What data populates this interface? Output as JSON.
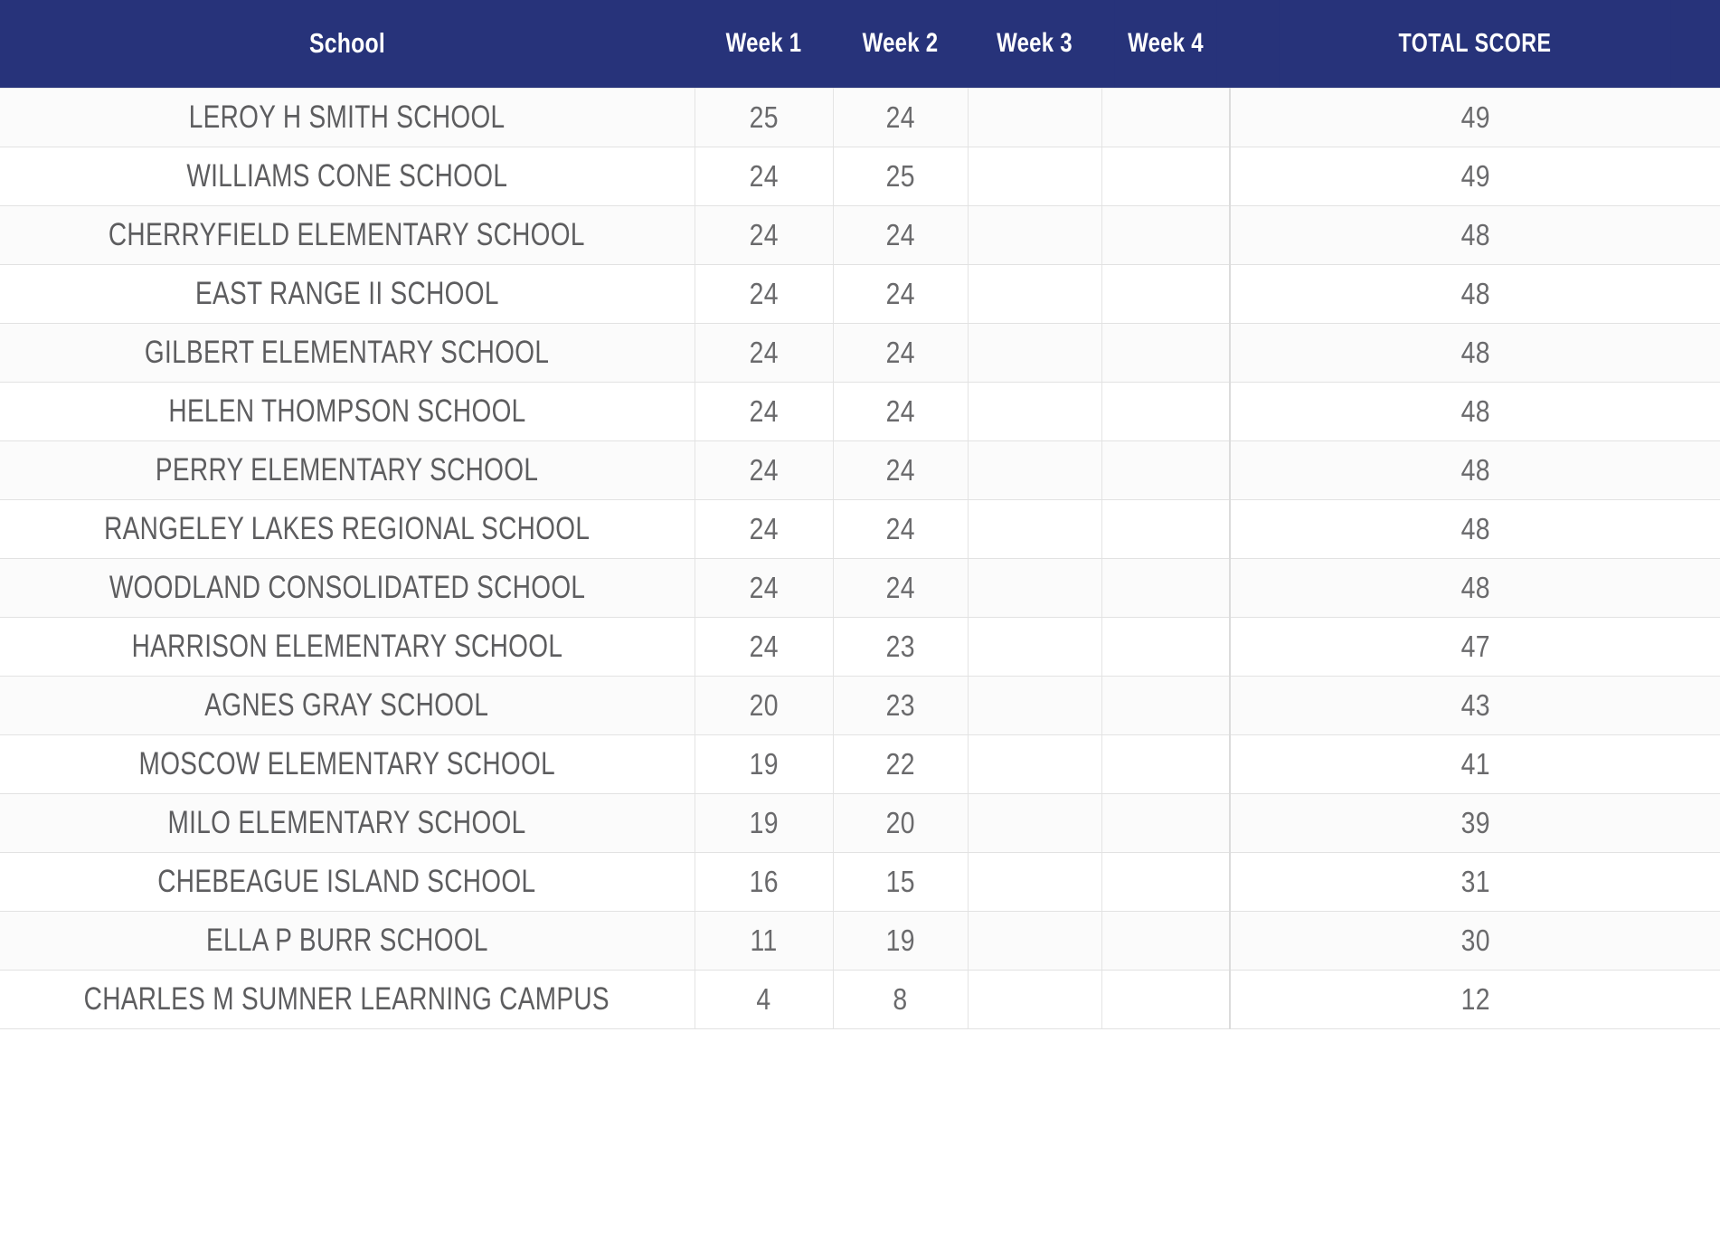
{
  "table": {
    "accent_color": "#27337a",
    "header_text_color": "#ffffff",
    "body_text_color": "#58585a",
    "row_alt_color": "#fbfbfb",
    "row_color": "#ffffff",
    "border_color": "#e4e4e4",
    "columns": [
      {
        "key": "school",
        "label": "School",
        "align": "center"
      },
      {
        "key": "week1",
        "label": "Week 1",
        "align": "center"
      },
      {
        "key": "week2",
        "label": "Week 2",
        "align": "center"
      },
      {
        "key": "week3",
        "label": "Week 3",
        "align": "center"
      },
      {
        "key": "week4",
        "label": "Week 4",
        "align": "center"
      },
      {
        "key": "total",
        "label": "TOTAL SCORE",
        "align": "center"
      }
    ],
    "rows": [
      {
        "school": "LEROY H SMITH SCHOOL",
        "week1": "25",
        "week2": "24",
        "week3": "",
        "week4": "",
        "total": "49"
      },
      {
        "school": "WILLIAMS CONE SCHOOL",
        "week1": "24",
        "week2": "25",
        "week3": "",
        "week4": "",
        "total": "49"
      },
      {
        "school": "CHERRYFIELD ELEMENTARY SCHOOL",
        "week1": "24",
        "week2": "24",
        "week3": "",
        "week4": "",
        "total": "48"
      },
      {
        "school": "EAST RANGE II SCHOOL",
        "week1": "24",
        "week2": "24",
        "week3": "",
        "week4": "",
        "total": "48"
      },
      {
        "school": "GILBERT ELEMENTARY SCHOOL",
        "week1": "24",
        "week2": "24",
        "week3": "",
        "week4": "",
        "total": "48"
      },
      {
        "school": "HELEN THOMPSON SCHOOL",
        "week1": "24",
        "week2": "24",
        "week3": "",
        "week4": "",
        "total": "48"
      },
      {
        "school": "PERRY ELEMENTARY SCHOOL",
        "week1": "24",
        "week2": "24",
        "week3": "",
        "week4": "",
        "total": "48"
      },
      {
        "school": "RANGELEY LAKES REGIONAL SCHOOL",
        "week1": "24",
        "week2": "24",
        "week3": "",
        "week4": "",
        "total": "48"
      },
      {
        "school": "WOODLAND CONSOLIDATED SCHOOL",
        "week1": "24",
        "week2": "24",
        "week3": "",
        "week4": "",
        "total": "48"
      },
      {
        "school": "HARRISON ELEMENTARY SCHOOL",
        "week1": "24",
        "week2": "23",
        "week3": "",
        "week4": "",
        "total": "47"
      },
      {
        "school": "AGNES GRAY SCHOOL",
        "week1": "20",
        "week2": "23",
        "week3": "",
        "week4": "",
        "total": "43"
      },
      {
        "school": "MOSCOW ELEMENTARY SCHOOL",
        "week1": "19",
        "week2": "22",
        "week3": "",
        "week4": "",
        "total": "41"
      },
      {
        "school": "MILO ELEMENTARY SCHOOL",
        "week1": "19",
        "week2": "20",
        "week3": "",
        "week4": "",
        "total": "39"
      },
      {
        "school": "CHEBEAGUE ISLAND SCHOOL",
        "week1": "16",
        "week2": "15",
        "week3": "",
        "week4": "",
        "total": "31"
      },
      {
        "school": "ELLA P BURR SCHOOL",
        "week1": "11",
        "week2": "19",
        "week3": "",
        "week4": "",
        "total": "30"
      },
      {
        "school": "CHARLES M SUMNER LEARNING CAMPUS",
        "week1": "4",
        "week2": "8",
        "week3": "",
        "week4": "",
        "total": "12"
      }
    ]
  }
}
